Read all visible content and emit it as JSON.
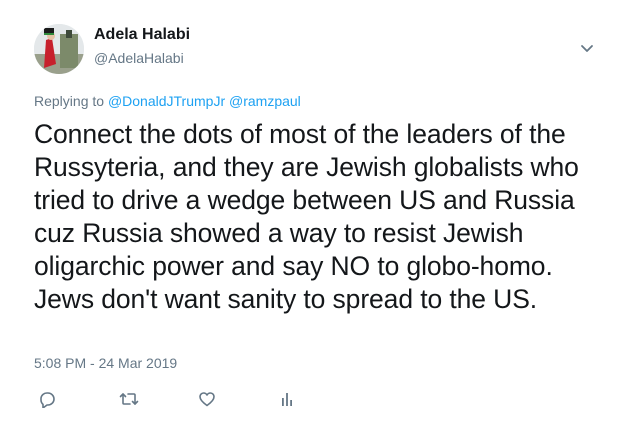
{
  "author": {
    "display_name": "Adela Halabi",
    "handle": "@AdelaHalabi"
  },
  "reply_context": {
    "prefix": "Replying to",
    "mentions": [
      "@DonaldJTrumpJr",
      "@ramzpaul"
    ]
  },
  "tweet": {
    "text": "Connect the dots of most of the leaders of the Russyteria, and they are Jewish globalists who tried to drive a wedge between US and Russia cuz Russia showed a way to resist Jewish oligarchic power and say NO to globo-homo. Jews don't want sanity to spread to the US.",
    "timestamp": "5:08 PM - 24 Mar 2019"
  },
  "actions": [
    {
      "icon": "reply-icon"
    },
    {
      "icon": "retweet-icon"
    },
    {
      "icon": "like-icon"
    },
    {
      "icon": "analytics-icon"
    }
  ],
  "colors": {
    "link": "#1da1f2",
    "secondary_text": "#657786",
    "primary_text": "#14171a"
  }
}
